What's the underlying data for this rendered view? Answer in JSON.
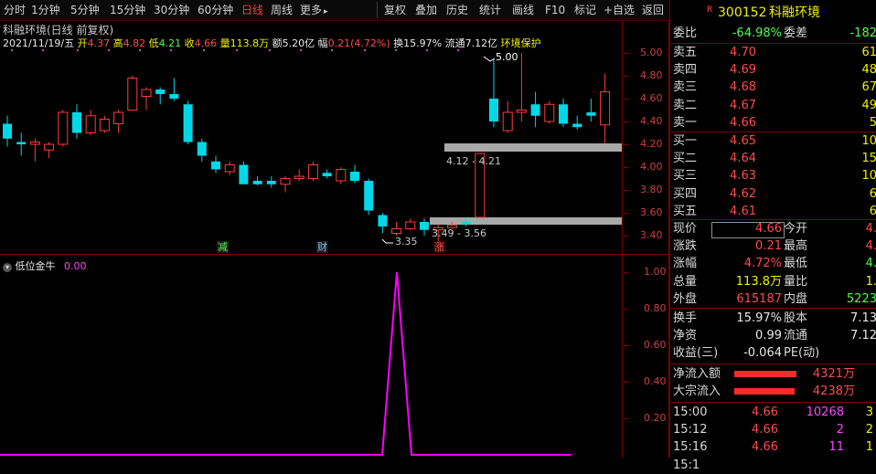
{
  "toolbar": {
    "tabs": [
      "分时",
      "1分钟",
      "5分钟",
      "15分钟",
      "30分钟",
      "60分钟",
      "日线",
      "周线",
      "更多"
    ],
    "active_tab": "日线",
    "more_arrow": "▸",
    "tools": [
      "复权",
      "叠加",
      "历史",
      "统计",
      "画线",
      "F10",
      "标记",
      "+自选",
      "返回"
    ]
  },
  "chart": {
    "title": "科融环境(日线 前复权)",
    "info": {
      "date": "2021/11/19/五",
      "open_label": "开",
      "open": "4.37",
      "high_label": "高",
      "high": "4.82",
      "low_label": "低",
      "low": "4.21",
      "close_label": "收",
      "close": "4.66",
      "vol_label": "量",
      "vol": "113.8万",
      "amount_label": "额",
      "amount": "5.20亿",
      "range_label": "幅",
      "range": "0.21(4.72%)",
      "turnover_label": "换",
      "turnover": "15.97%",
      "float_label": "流通",
      "float": "7.12亿",
      "concept": "环境保护"
    },
    "y_ticks": [
      "5.00",
      "4.80",
      "4.60",
      "4.40",
      "4.20",
      "4.00",
      "3.80",
      "3.60",
      "3.40"
    ],
    "annotations": {
      "peak": "5.00",
      "box_upper": "4.12 - 4.21",
      "box_lower": "3.49 - 3.56",
      "low_mark": "3.35"
    },
    "markers": [
      "减",
      "财",
      "涨"
    ],
    "candles": [
      {
        "o": 4.38,
        "h": 4.45,
        "l": 4.18,
        "c": 4.25
      },
      {
        "o": 4.22,
        "h": 4.3,
        "l": 4.1,
        "c": 4.2
      },
      {
        "o": 4.2,
        "h": 4.25,
        "l": 4.05,
        "c": 4.22
      },
      {
        "o": 4.15,
        "h": 4.22,
        "l": 4.08,
        "c": 4.2
      },
      {
        "o": 4.2,
        "h": 4.5,
        "l": 4.18,
        "c": 4.48
      },
      {
        "o": 4.48,
        "h": 4.55,
        "l": 4.25,
        "c": 4.3
      },
      {
        "o": 4.3,
        "h": 4.5,
        "l": 4.28,
        "c": 4.45
      },
      {
        "o": 4.32,
        "h": 4.45,
        "l": 4.3,
        "c": 4.42
      },
      {
        "o": 4.38,
        "h": 4.5,
        "l": 4.3,
        "c": 4.48
      },
      {
        "o": 4.5,
        "h": 4.8,
        "l": 4.5,
        "c": 4.78
      },
      {
        "o": 4.62,
        "h": 4.7,
        "l": 4.5,
        "c": 4.68
      },
      {
        "o": 4.68,
        "h": 4.7,
        "l": 4.55,
        "c": 4.64
      },
      {
        "o": 4.64,
        "h": 4.78,
        "l": 4.58,
        "c": 4.6
      },
      {
        "o": 4.55,
        "h": 4.58,
        "l": 4.2,
        "c": 4.22
      },
      {
        "o": 4.22,
        "h": 4.25,
        "l": 4.05,
        "c": 4.1
      },
      {
        "o": 4.05,
        "h": 4.1,
        "l": 3.95,
        "c": 3.98
      },
      {
        "o": 3.96,
        "h": 4.05,
        "l": 3.93,
        "c": 4.02
      },
      {
        "o": 4.02,
        "h": 4.05,
        "l": 3.85,
        "c": 3.85
      },
      {
        "o": 3.88,
        "h": 3.92,
        "l": 3.84,
        "c": 3.85
      },
      {
        "o": 3.88,
        "h": 3.92,
        "l": 3.82,
        "c": 3.85
      },
      {
        "o": 3.85,
        "h": 3.92,
        "l": 3.78,
        "c": 3.9
      },
      {
        "o": 3.9,
        "h": 3.98,
        "l": 3.88,
        "c": 3.92
      },
      {
        "o": 3.9,
        "h": 4.05,
        "l": 3.88,
        "c": 4.02
      },
      {
        "o": 3.95,
        "h": 3.98,
        "l": 3.9,
        "c": 3.92
      },
      {
        "o": 3.88,
        "h": 4.0,
        "l": 3.85,
        "c": 3.98
      },
      {
        "o": 3.96,
        "h": 4.02,
        "l": 3.86,
        "c": 3.88
      },
      {
        "o": 3.88,
        "h": 3.9,
        "l": 3.58,
        "c": 3.62
      },
      {
        "o": 3.58,
        "h": 3.6,
        "l": 3.42,
        "c": 3.48
      },
      {
        "o": 3.42,
        "h": 3.52,
        "l": 3.4,
        "c": 3.46
      },
      {
        "o": 3.46,
        "h": 3.55,
        "l": 3.45,
        "c": 3.52
      },
      {
        "o": 3.52,
        "h": 3.55,
        "l": 3.4,
        "c": 3.45
      },
      {
        "o": 3.45,
        "h": 3.5,
        "l": 3.35,
        "c": 3.47
      },
      {
        "o": 3.47,
        "h": 3.52,
        "l": 3.46,
        "c": 3.49
      },
      {
        "o": 3.52,
        "h": 3.55,
        "l": 3.48,
        "c": 3.5
      },
      {
        "o": 3.56,
        "h": 4.12,
        "l": 3.56,
        "c": 4.12
      },
      {
        "o": 4.6,
        "h": 4.95,
        "l": 4.35,
        "c": 4.4
      },
      {
        "o": 4.32,
        "h": 4.58,
        "l": 4.3,
        "c": 4.48
      },
      {
        "o": 4.48,
        "h": 5.0,
        "l": 4.4,
        "c": 4.5
      },
      {
        "o": 4.55,
        "h": 4.66,
        "l": 4.35,
        "c": 4.45
      },
      {
        "o": 4.4,
        "h": 4.58,
        "l": 4.38,
        "c": 4.55
      },
      {
        "o": 4.55,
        "h": 4.6,
        "l": 4.35,
        "c": 4.38
      },
      {
        "o": 4.38,
        "h": 4.45,
        "l": 4.33,
        "c": 4.35
      },
      {
        "o": 4.48,
        "h": 4.6,
        "l": 4.4,
        "c": 4.45
      },
      {
        "o": 4.37,
        "h": 4.82,
        "l": 4.21,
        "c": 4.66
      }
    ]
  },
  "indicator": {
    "name": "低位金牛",
    "value": "0.00",
    "y_ticks": [
      "1.00",
      "0.80",
      "0.60",
      "0.40",
      "0.20"
    ]
  },
  "panel": {
    "code": "300152",
    "name": "科融环境",
    "wei_bi_label": "委比",
    "wei_bi": "-64.98%",
    "wei_cha_label": "委差",
    "wei_cha": "-182",
    "asks": [
      {
        "label": "卖五",
        "price": "4.70",
        "vol": "61"
      },
      {
        "label": "卖四",
        "price": "4.69",
        "vol": "48"
      },
      {
        "label": "卖三",
        "price": "4.68",
        "vol": "67"
      },
      {
        "label": "卖二",
        "price": "4.67",
        "vol": "49"
      },
      {
        "label": "卖一",
        "price": "4.66",
        "vol": "5"
      }
    ],
    "bids": [
      {
        "label": "买一",
        "price": "4.65",
        "vol": "10"
      },
      {
        "label": "买二",
        "price": "4.64",
        "vol": "15"
      },
      {
        "label": "买三",
        "price": "4.63",
        "vol": "10"
      },
      {
        "label": "买四",
        "price": "4.62",
        "vol": "6"
      },
      {
        "label": "买五",
        "price": "4.61",
        "vol": "6"
      }
    ],
    "quote": [
      {
        "l1": "现价",
        "v1": "4.66",
        "l2": "今开",
        "v2": "4."
      },
      {
        "l1": "涨跌",
        "v1": "0.21",
        "l2": "最高",
        "v2": "4."
      },
      {
        "l1": "涨幅",
        "v1": "4.72%",
        "l2": "最低",
        "v2": "4."
      },
      {
        "l1": "总量",
        "v1": "113.8万",
        "l2": "量比",
        "v2": "1."
      },
      {
        "l1": "外盘",
        "v1": "615187",
        "l2": "内盘",
        "v2": "5223"
      }
    ],
    "finance": [
      {
        "l1": "换手",
        "v1": "15.97%",
        "l2": "股本",
        "v2": "7.13"
      },
      {
        "l1": "净资",
        "v1": "0.99",
        "l2": "流通",
        "v2": "7.12"
      },
      {
        "l1": "收益(三)",
        "v1": "-0.064",
        "l2": "PE(动)",
        "v2": ""
      }
    ],
    "flows": [
      {
        "label": "净流入额",
        "value": "4321万",
        "fill": 0.85
      },
      {
        "label": "大宗流入",
        "value": "4238万",
        "fill": 0.83
      }
    ],
    "ticks": [
      {
        "time": "15:00",
        "price": "4.66",
        "vol": "10268",
        "x": "3"
      },
      {
        "time": "15:12",
        "price": "4.66",
        "vol": "2",
        "x": "2"
      },
      {
        "time": "15:16",
        "price": "4.66",
        "vol": "11",
        "x": "1"
      },
      {
        "time": "15:1",
        "price": "",
        "vol": "",
        "x": ""
      }
    ]
  },
  "colors": {
    "up": "#ff3b3b",
    "down": "#00d8e8",
    "frame": "#7a0000",
    "indicator": "#ff00ff",
    "annot_box": "#a8a8a8"
  }
}
